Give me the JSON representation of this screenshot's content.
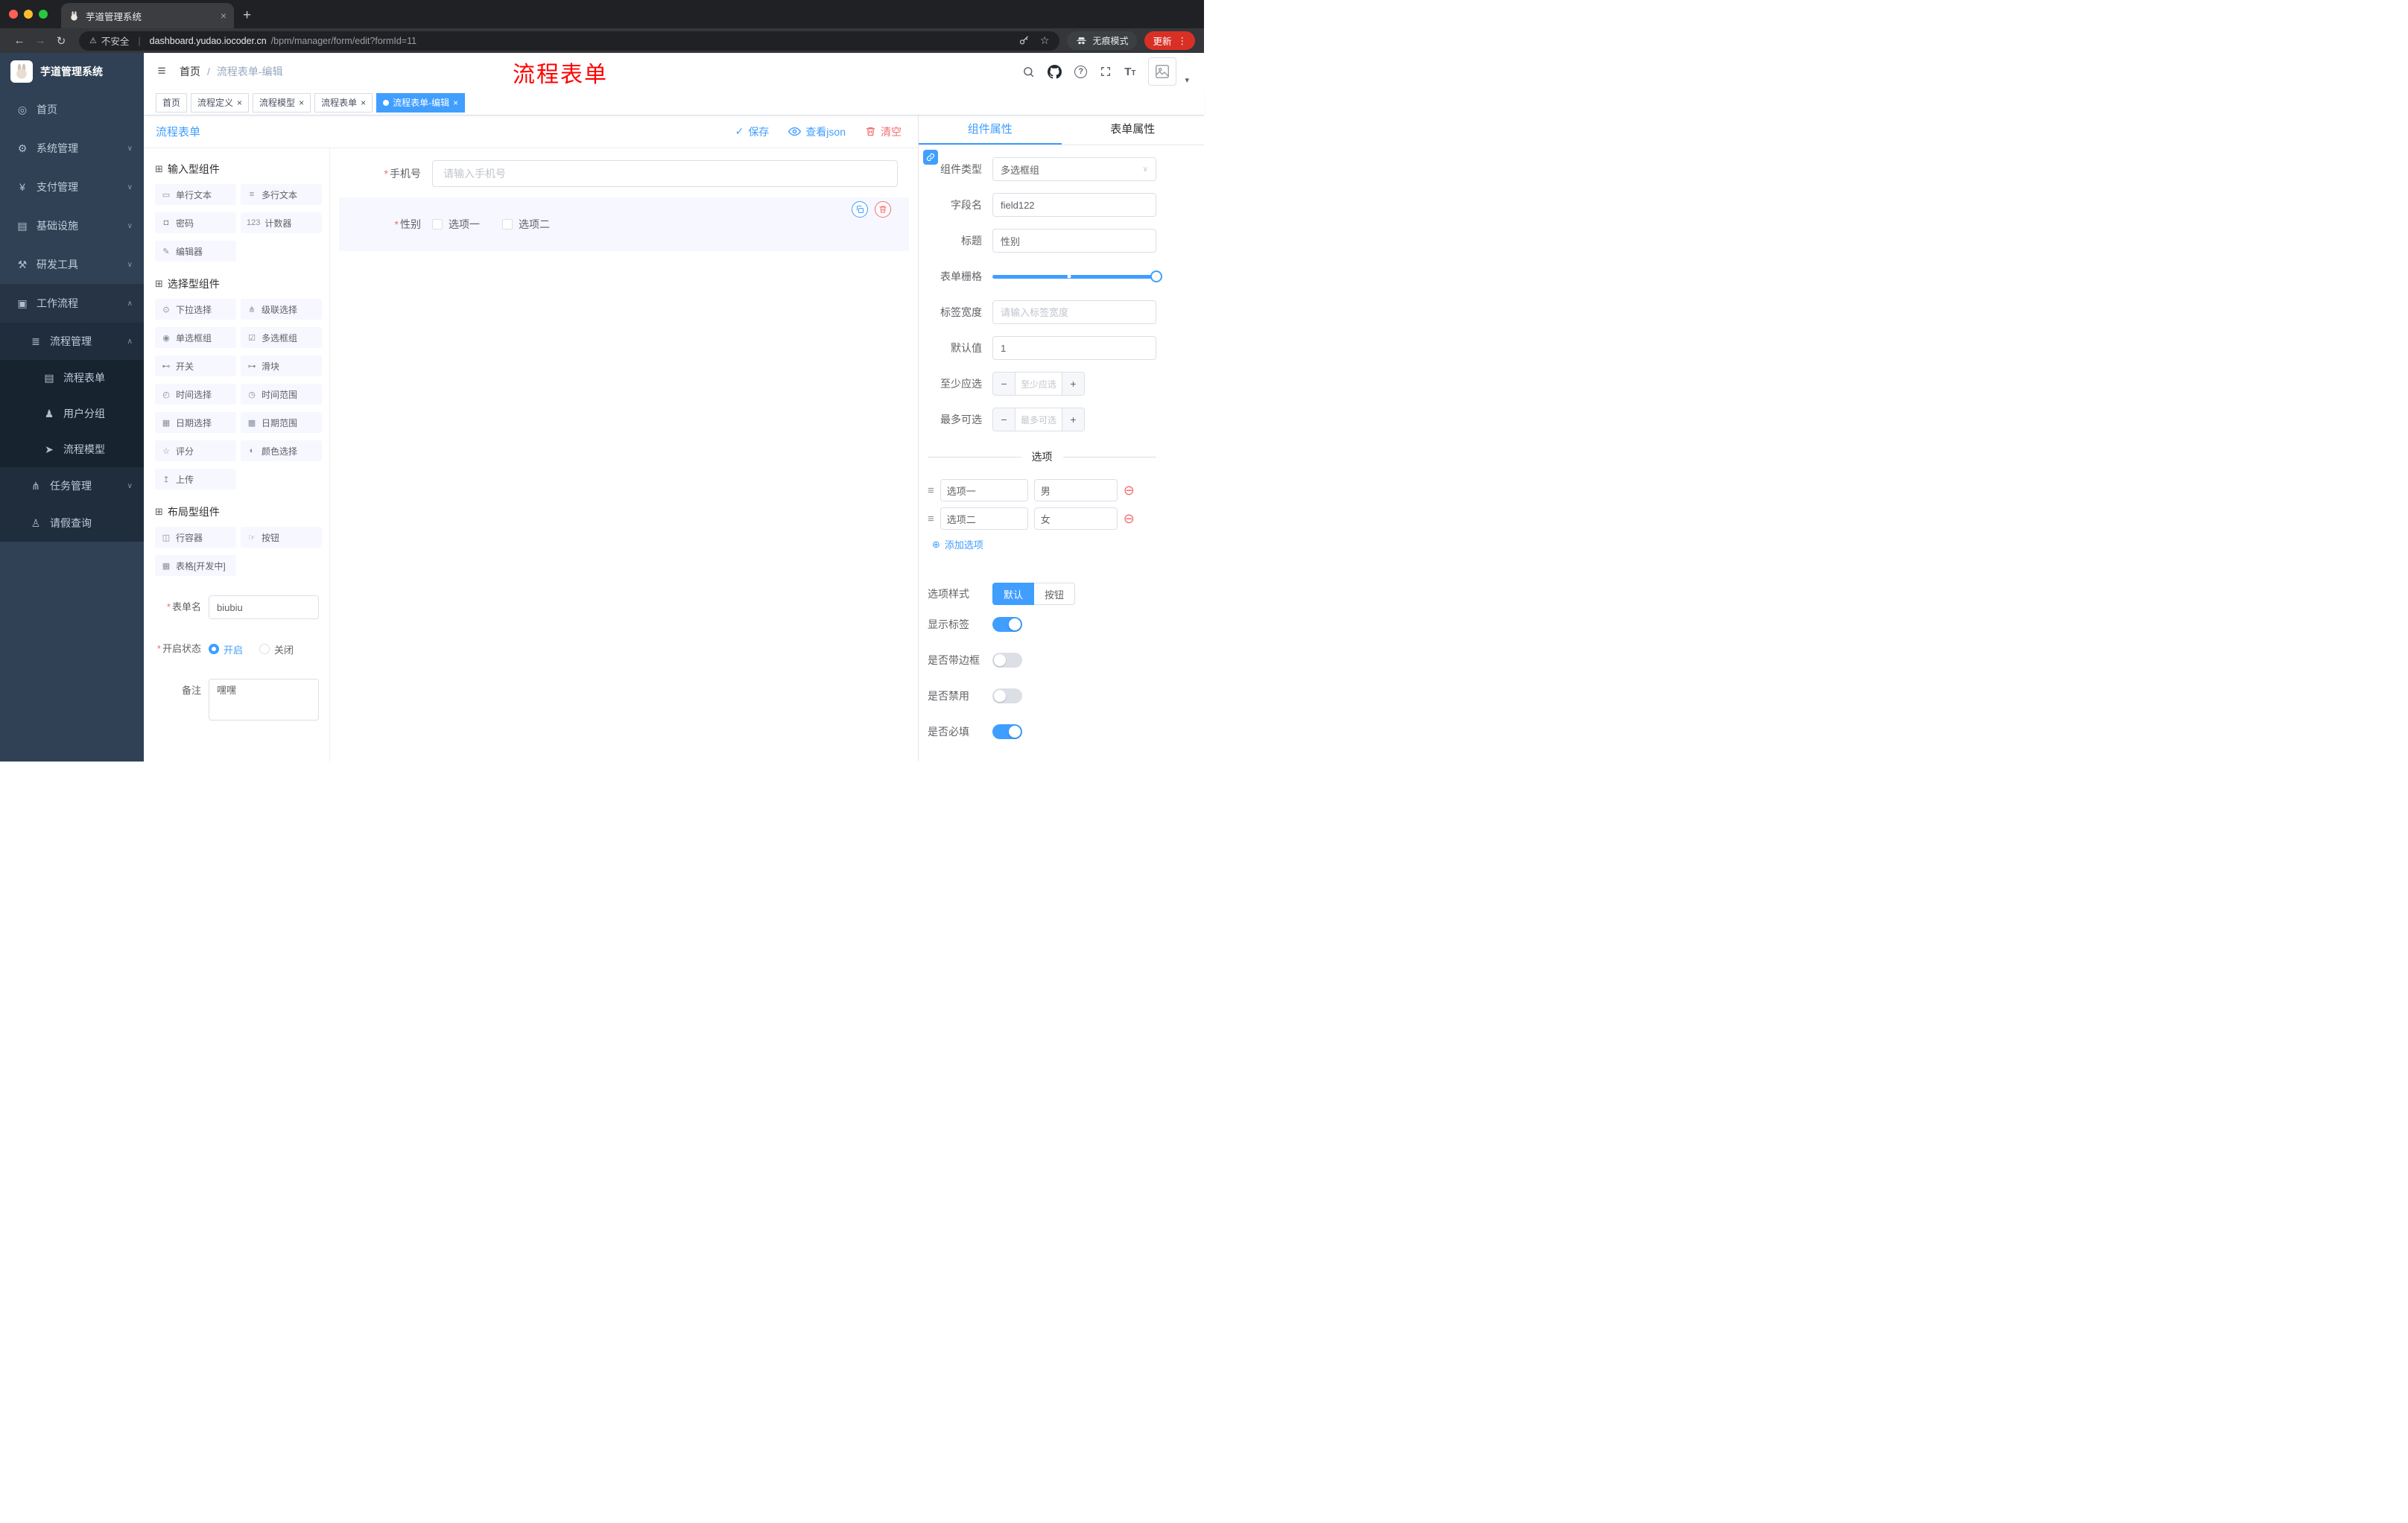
{
  "icons": {
    "close": "×",
    "new_tab": "+",
    "back": "←",
    "forward": "→",
    "reload": "↻",
    "warning": "⚠",
    "star": "☆",
    "kebab": "⋮",
    "pipe": "|",
    "hamburger": "≡",
    "crumb_sep": "/",
    "question": "?",
    "chevron_down": "∨",
    "chevron_up": "∧",
    "caret_down": "▾",
    "check": "✓",
    "minus": "−",
    "plus": "+",
    "circle_minus": "⊖",
    "circle_plus": "⊕",
    "drag_handle": "≡",
    "required": "*",
    "select_caret": "∨",
    "group": "⊞",
    "font_large": "T",
    "font_small": "T"
  },
  "browser": {
    "tab_title": "芋道管理系统",
    "security_label": "不安全",
    "url_domain": "dashboard.yudao.iocoder.cn",
    "url_path": "/bpm/manager/form/edit?formId=11",
    "incognito_label": "无痕模式",
    "update_label": "更新"
  },
  "sidebar": {
    "logo_title": "芋道管理系统",
    "items": [
      {
        "label": "首页",
        "glyph": "◎"
      },
      {
        "label": "系统管理",
        "glyph": "⚙"
      },
      {
        "label": "支付管理",
        "glyph": "¥"
      },
      {
        "label": "基础设施",
        "glyph": "▤"
      },
      {
        "label": "研发工具",
        "glyph": "⚒"
      },
      {
        "label": "工作流程",
        "glyph": "▣"
      },
      {
        "label": "流程管理",
        "glyph": "≣"
      },
      {
        "label": "流程表单",
        "glyph": "▤"
      },
      {
        "label": "用户分组",
        "glyph": "♟"
      },
      {
        "label": "流程模型",
        "glyph": "➤"
      },
      {
        "label": "任务管理",
        "glyph": "⋔"
      },
      {
        "label": "请假查询",
        "glyph": "♙"
      }
    ]
  },
  "header": {
    "breadcrumb_home": "首页",
    "breadcrumb_current": "流程表单-编辑",
    "annotation": "流程表单"
  },
  "tags": [
    {
      "label": "首页",
      "closable": false,
      "active": false
    },
    {
      "label": "流程定义",
      "closable": true,
      "active": false
    },
    {
      "label": "流程模型",
      "closable": true,
      "active": false
    },
    {
      "label": "流程表单",
      "closable": true,
      "active": false
    },
    {
      "label": "流程表单-编辑",
      "closable": true,
      "active": true
    }
  ],
  "toolbar": {
    "title": "流程表单",
    "save": "保存",
    "view_json": "查看json",
    "clear": "清空"
  },
  "palette": {
    "groups": [
      {
        "title": "输入型组件"
      },
      {
        "title": "选择型组件"
      },
      {
        "title": "布局型组件"
      }
    ],
    "inputs": [
      {
        "label": "单行文本",
        "glyph": "▭"
      },
      {
        "label": "多行文本",
        "glyph": "≡"
      },
      {
        "label": "密码",
        "glyph": "◘"
      },
      {
        "label": "计数器",
        "glyph": "123"
      },
      {
        "label": "编辑器",
        "glyph": "✎"
      }
    ],
    "selects": [
      {
        "label": "下拉选择",
        "glyph": "⊙"
      },
      {
        "label": "级联选择",
        "glyph": "⋔"
      },
      {
        "label": "单选框组",
        "glyph": "◉"
      },
      {
        "label": "多选框组",
        "glyph": "☑"
      },
      {
        "label": "开关",
        "glyph": "⊷"
      },
      {
        "label": "滑块",
        "glyph": "⊶"
      },
      {
        "label": "时间选择",
        "glyph": "◴"
      },
      {
        "label": "时间范围",
        "glyph": "◷"
      },
      {
        "label": "日期选择",
        "glyph": "▦"
      },
      {
        "label": "日期范围",
        "glyph": "▩"
      },
      {
        "label": "评分",
        "glyph": "☆"
      },
      {
        "label": "颜色选择",
        "glyph": "◐"
      },
      {
        "label": "上传",
        "glyph": "↥"
      }
    ],
    "layouts": [
      {
        "label": "行容器",
        "glyph": "◫"
      },
      {
        "label": "按钮",
        "glyph": "☞"
      },
      {
        "label": "表格[开发中]",
        "glyph": "▦"
      }
    ],
    "form": {
      "name_label": "表单名",
      "name_value": "biubiu",
      "status_label": "开启状态",
      "status_on": "开启",
      "status_off": "关闭",
      "status_checked": "开启",
      "remark_label": "备注",
      "remark_value": "嘿嘿"
    }
  },
  "canvas": {
    "phone_label": "手机号",
    "phone_placeholder": "请输入手机号",
    "gender_label": "性别",
    "gender_opt1": "选项一",
    "gender_opt2": "选项二"
  },
  "props": {
    "tab_component": "组件属性",
    "tab_form": "表单属性",
    "active_tab": "组件属性",
    "type_label": "组件类型",
    "type_value": "多选框组",
    "field_label": "字段名",
    "field_value": "field122",
    "title_label": "标题",
    "title_value": "性别",
    "grid_label": "表单栅格",
    "labelw_label": "标签宽度",
    "labelw_placeholder": "请输入标签宽度",
    "default_label": "默认值",
    "default_value": "1",
    "min_label": "至少应选",
    "min_placeholder": "至少应选",
    "max_label": "最多可选",
    "max_placeholder": "最多可选",
    "options_title": "选项",
    "opt1_label": "选项一",
    "opt1_value": "男",
    "opt2_label": "选项二",
    "opt2_value": "女",
    "add_option": "添加选项",
    "style_label": "选项样式",
    "style_default": "默认",
    "style_button": "按钮",
    "style_selected": "默认",
    "sw_show_label": "显示标签",
    "sw_show_on": true,
    "sw_border_label": "是否带边框",
    "sw_border_on": false,
    "sw_disabled_label": "是否禁用",
    "sw_disabled_on": false,
    "sw_required_label": "是否必填",
    "sw_required_on": true
  }
}
